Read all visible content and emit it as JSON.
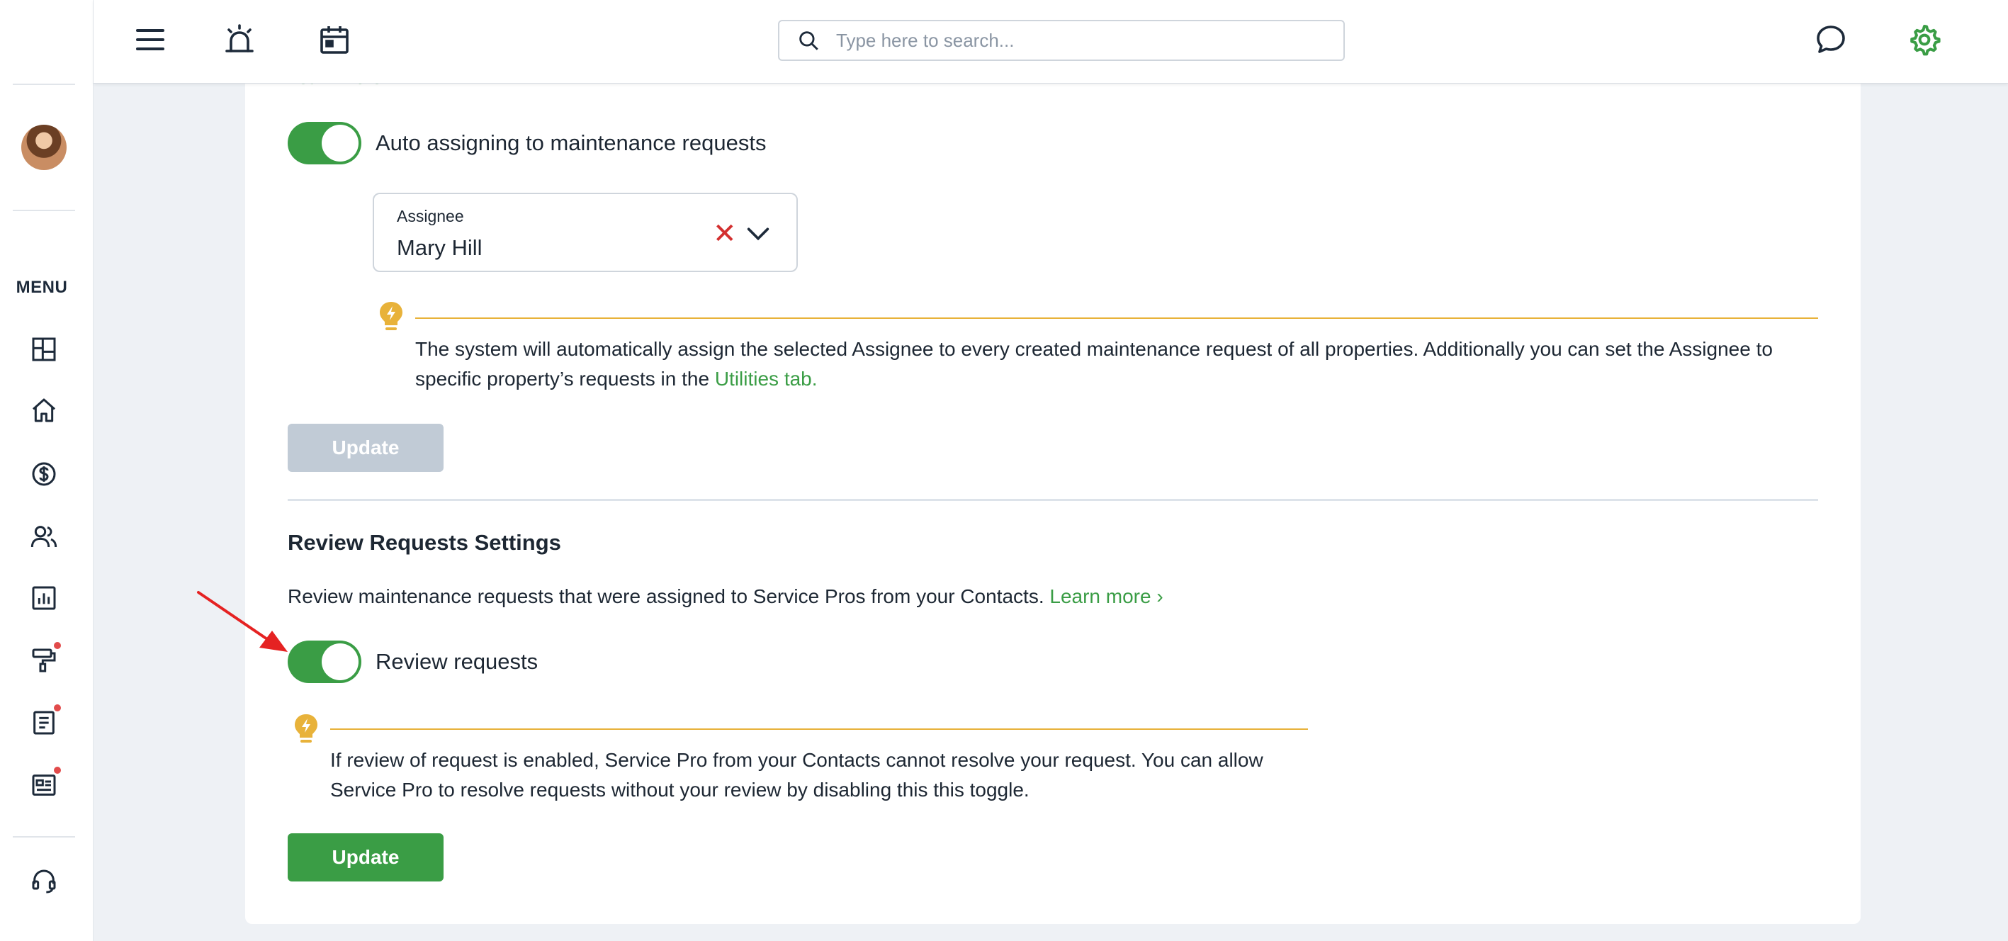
{
  "topbar": {
    "search_placeholder": "Type here to search..."
  },
  "sidebar": {
    "menu_label": "MENU"
  },
  "assign": {
    "toggle_label": "Auto assigning to maintenance requests",
    "assignee_label": "Assignee",
    "assignee_value": "Mary Hill",
    "hint_text": "The system will automatically assign the selected Assignee to every created maintenance request of all properties. Additionally you can set the Assignee to specific property’s requests in the",
    "hint_link": "Utilities tab.",
    "update_label": "Update"
  },
  "review": {
    "title": "Review Requests Settings",
    "description": "Review maintenance requests that were assigned to Service Pros from your Contacts.",
    "learn_more": "Learn more",
    "toggle_label": "Review requests",
    "hint_text": "If review of request is enabled, Service Pro from your Contacts cannot resolve your request. You can allow Service Pro to resolve requests without your review by disabling this this toggle.",
    "update_label": "Update"
  },
  "cut_off_link": "Learn more",
  "colors": {
    "accent": "#3a9d45",
    "warning": "#e8b23a",
    "clear": "#d32f2f",
    "notification": "#e24b4b"
  }
}
